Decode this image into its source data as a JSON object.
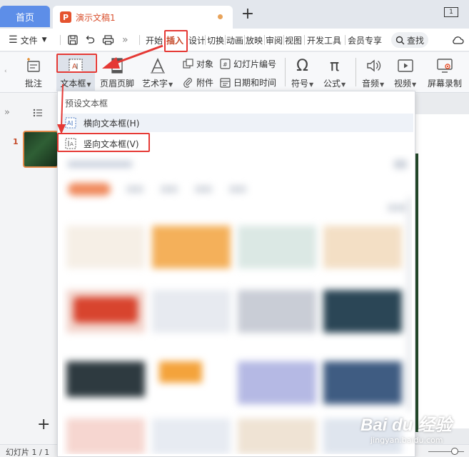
{
  "titlebar": {
    "home_tab": "首页",
    "doc_icon": "P",
    "doc_title": "演示文稿1",
    "new_tab": "+",
    "window_count": "1"
  },
  "menubar": {
    "file": "文件",
    "tabs": [
      "开始",
      "插入",
      "设计",
      "切换",
      "动画",
      "放映",
      "审阅",
      "视图",
      "开发工具",
      "会员专享"
    ],
    "active_tab": "插入",
    "search": "查找",
    "more": "»"
  },
  "ribbon": {
    "comment": "批注",
    "textbox": "文本框",
    "header_footer": "页眉页脚",
    "art_text": "艺术字",
    "object": "对象",
    "attachment": "附件",
    "slide_number": "幻灯片编号",
    "date_time": "日期和时间",
    "symbol": "符号",
    "formula": "公式",
    "audio": "音频",
    "video": "视频",
    "screen_record": "屏幕录制"
  },
  "left_panel": {
    "slide_index": "1",
    "add_slide": "+",
    "collapse": "»"
  },
  "dropdown": {
    "header": "预设文本框",
    "horizontal": "横向文本框(H)",
    "vertical": "竖向文本框(V)"
  },
  "statusbar": {
    "slide_info": "幻灯片 1 / 1"
  },
  "watermark": {
    "logo": "Bai du 经验",
    "url": "jingyan.baidu.com"
  },
  "colors": {
    "accent": "#e5532f",
    "home_tab": "#5d8ee8",
    "highlight": "#e53935"
  }
}
